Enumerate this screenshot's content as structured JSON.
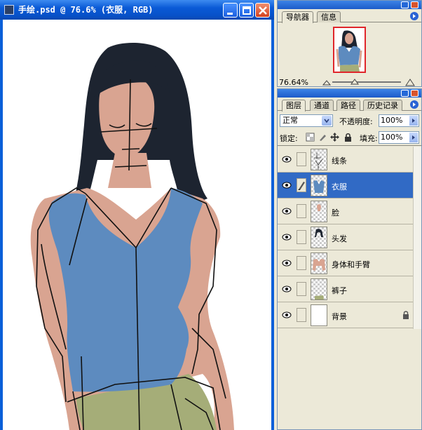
{
  "document": {
    "title": "手绘.psd @ 76.6% (衣服, RGB)"
  },
  "navigator": {
    "tabs": [
      "导航器",
      "信息"
    ],
    "zoom": "76.64%"
  },
  "layers_panel": {
    "tabs": [
      "图层",
      "通道",
      "路径",
      "历史记录"
    ],
    "blend_mode": "正常",
    "opacity_label": "不透明度:",
    "opacity_value": "100%",
    "lock_label": "锁定:",
    "fill_label": "填充:",
    "fill_value": "100%",
    "layers": [
      {
        "name": "线条",
        "selected": false,
        "thumb": "lines"
      },
      {
        "name": "衣服",
        "selected": true,
        "thumb": "shirt"
      },
      {
        "name": "脸",
        "selected": false,
        "thumb": "face"
      },
      {
        "name": "头发",
        "selected": false,
        "thumb": "hair"
      },
      {
        "name": "身体和手臂",
        "selected": false,
        "thumb": "body"
      },
      {
        "name": "裤子",
        "selected": false,
        "thumb": "pants"
      },
      {
        "name": "背景",
        "selected": false,
        "thumb": "background"
      }
    ]
  },
  "colors": {
    "skin": "#d9a491",
    "shirt": "#5d8bbf",
    "hair": "#1d2430",
    "pants": "#a5ad78",
    "selection": "#316ac5"
  }
}
